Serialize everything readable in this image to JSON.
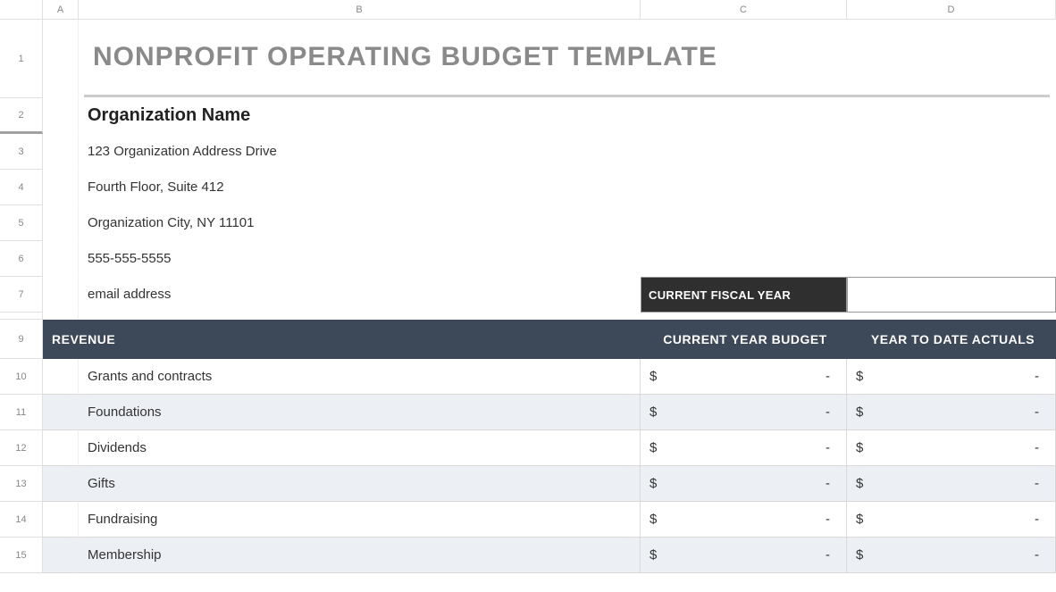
{
  "columns": [
    "A",
    "B",
    "C",
    "D"
  ],
  "rows": [
    "1",
    "2",
    "3",
    "4",
    "5",
    "6",
    "7",
    "9",
    "10",
    "11",
    "12",
    "13",
    "14",
    "15"
  ],
  "doc": {
    "title": "NONPROFIT OPERATING BUDGET TEMPLATE",
    "org_name": "Organization Name",
    "address1": "123 Organization Address Drive",
    "address2": "Fourth Floor, Suite 412",
    "city": "Organization City, NY  11101",
    "phone": "555-555-5555",
    "email": "email address"
  },
  "fiscal": {
    "label": "CURRENT FISCAL YEAR",
    "value": ""
  },
  "table": {
    "section_label": "REVENUE",
    "col_budget": "CURRENT YEAR BUDGET",
    "col_actuals": "YEAR TO DATE ACTUALS",
    "currency": "$",
    "dash": "-",
    "rows": [
      {
        "label": "Grants and contracts"
      },
      {
        "label": "Foundations"
      },
      {
        "label": "Dividends"
      },
      {
        "label": "Gifts"
      },
      {
        "label": "Fundraising"
      },
      {
        "label": "Membership"
      }
    ]
  }
}
